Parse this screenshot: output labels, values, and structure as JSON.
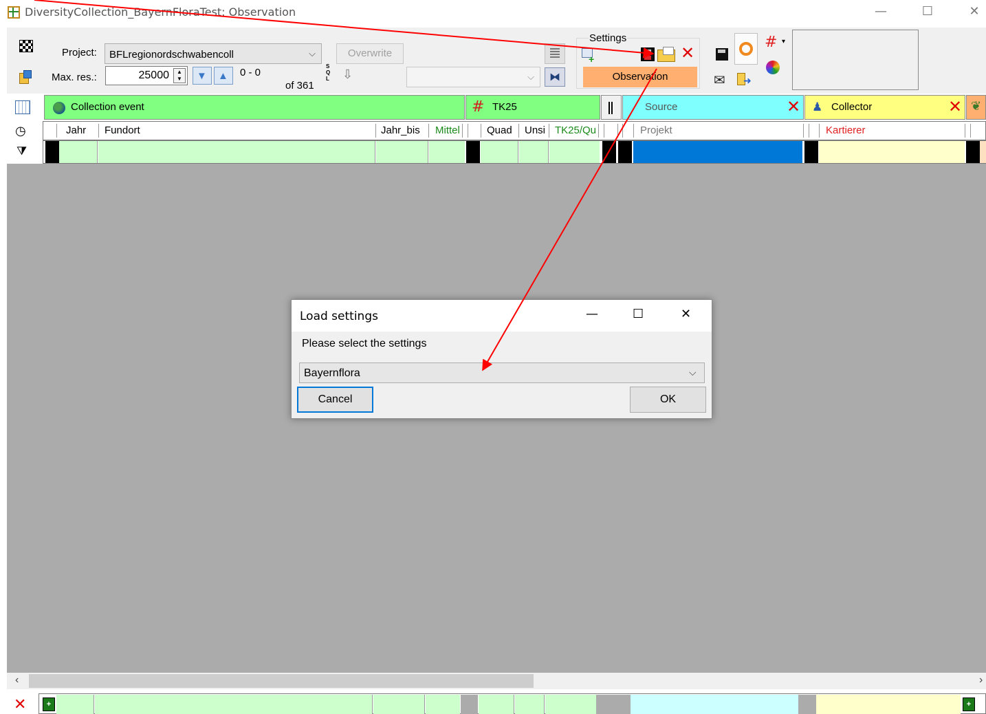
{
  "window": {
    "title": "DiversityCollection_BayernFloraTest: Observation",
    "minimize": "—",
    "maximize": "☐",
    "close": "✕"
  },
  "toolbar": {
    "project_label": "Project:",
    "project_value": "BFLregionordschwabencoll",
    "maxres_label": "Max. res.:",
    "maxres_value": "25000",
    "range": "0 - 0",
    "of_count": "of 361",
    "overwrite_label": "Overwrite",
    "sql_label": "SQL",
    "settings_label": "Settings",
    "observation_label": "Observation"
  },
  "groups": {
    "collection_event": "Collection event",
    "tk25": "TK25",
    "source": "Source",
    "collector": "Collector"
  },
  "columns": {
    "jahr": "Jahr",
    "fundort": "Fundort",
    "jahr_bis": "Jahr_bis",
    "mittel": "Mittel",
    "quad": "Quad",
    "unsi": "Unsi",
    "tk25qu": "TK25/Qu",
    "projekt": "Projekt",
    "kartierer": "Kartierer"
  },
  "dialog": {
    "title": "Load settings",
    "prompt": "Please select the settings",
    "selected": "Bayernflora",
    "cancel": "Cancel",
    "ok": "OK"
  },
  "colors": {
    "collection_event": "#80ff80",
    "tk25": "#80ff80",
    "source": "#80ffff",
    "collector": "#ffff80",
    "observation": "#ffb070",
    "selection_blue": "#0078d7",
    "arrow": "#ff0000"
  }
}
